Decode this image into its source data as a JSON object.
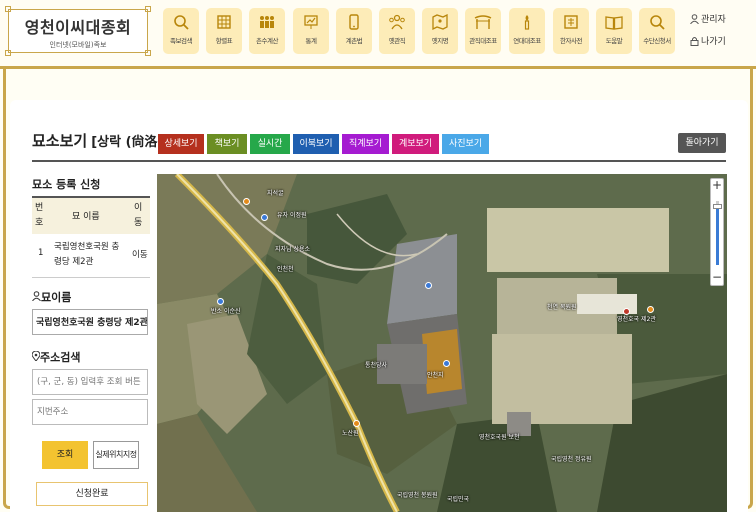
{
  "logo": {
    "title": "영천이씨대종회",
    "subtitle": "인터넷(모바일)족보"
  },
  "nav": [
    {
      "label": "족보검색",
      "icon": "search-icon"
    },
    {
      "label": "항렬표",
      "icon": "grid-icon"
    },
    {
      "label": "촌수계산",
      "icon": "family-icon"
    },
    {
      "label": "통계",
      "icon": "chart-icon"
    },
    {
      "label": "계촌법",
      "icon": "mobile-icon"
    },
    {
      "label": "옛관직",
      "icon": "people-icon"
    },
    {
      "label": "옛지명",
      "icon": "map-icon"
    },
    {
      "label": "관직대조표",
      "icon": "gate-icon"
    },
    {
      "label": "연대대조표",
      "icon": "torch-icon"
    },
    {
      "label": "한자사전",
      "icon": "dictionary-icon"
    },
    {
      "label": "도움말",
      "icon": "book-icon"
    },
    {
      "label": "수단신청서",
      "icon": "search-icon"
    }
  ],
  "user": {
    "admin": "관리자",
    "logout": "나가기"
  },
  "page": {
    "title": "묘소보기",
    "subtitle": "[상락 (尙洛)]",
    "back": "돌아가기"
  },
  "tabs": [
    {
      "label": "상세보기",
      "color": "#b5301e"
    },
    {
      "label": "책보기",
      "color": "#6b8e23"
    },
    {
      "label": "실시간",
      "color": "#26a84a"
    },
    {
      "label": "이북보기",
      "color": "#1f5fb0"
    },
    {
      "label": "직계보기",
      "color": "#a51bd1"
    },
    {
      "label": "계보보기",
      "color": "#d01b7c"
    },
    {
      "label": "사진보기",
      "color": "#4aa8e8"
    }
  ],
  "register": {
    "heading": "묘소 등록 신청",
    "col_no": "번호",
    "col_name": "묘 이름",
    "col_move": "이동",
    "row_no": "1",
    "row_name": "국립영천호국원 충령당 제2관",
    "row_move": "이동"
  },
  "grave_name": {
    "label": "묘이름",
    "value": "국립영천호국원 충령당 제2관"
  },
  "address": {
    "label": "주소검색",
    "placeholder1": "(구, 군, 동) 입력후 조회 버튼",
    "placeholder2": "지번주소",
    "search": "조회",
    "set_location": "실제위치지정",
    "done": "신청완료"
  },
  "map": {
    "labels": [
      "지석굴",
      "유자 이정원",
      "지자님 상용소",
      "인천천",
      "반소 이순신",
      "통천당사",
      "안천지",
      "천연 복원원",
      "영천호국 제2관",
      "노산원",
      "영천호국원 보천",
      "국립영천 정유원",
      "국립영천 봉원원",
      "국립민국"
    ]
  }
}
